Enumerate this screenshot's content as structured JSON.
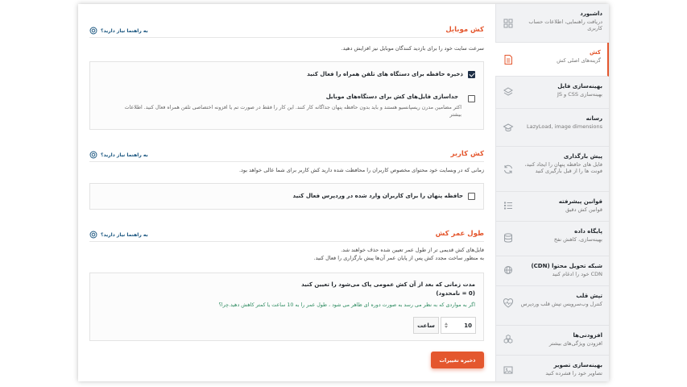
{
  "colors": {
    "accent": "#e4572e",
    "link": "#15527d",
    "nav_active_bg": "#ffffff"
  },
  "sidebar": {
    "items": [
      {
        "title": "داشبورد",
        "desc": "دریافت راهنمایی، اطلاعات حساب کاربری",
        "icon": "dashboard-icon"
      },
      {
        "title": "کش",
        "desc": "گزینه‌های اصلی کش",
        "icon": "file-cache-icon",
        "active": true
      },
      {
        "title": "بهینه‌سازی فایل",
        "desc": "بهینه‌سازی CSS و JS",
        "icon": "layers-icon"
      },
      {
        "title": "رسانه",
        "desc": "LazyLoad, image dimensions",
        "icon": "media-icon"
      },
      {
        "title": "پیش بارگذاری",
        "desc": "فایل های حافظه پنهان را ایجاد کنید، فونت ها را از قبل بارگیری کنید",
        "icon": "refresh-icon"
      },
      {
        "title": "قوانین پیشرفته",
        "desc": "قوانین کش دقیق",
        "icon": "rules-list-icon"
      },
      {
        "title": "پایگاه داده",
        "desc": "بهینه‌سازی، کاهش نفخ",
        "icon": "database-icon"
      },
      {
        "title": "شبکه تحویل محتوا (CDN)",
        "desc": "CDN خود را ادغام کنید",
        "icon": "cdn-icon"
      },
      {
        "title": "تپش قلب",
        "desc": "کنترل وب‌سرویس تپش قلب وردپرس",
        "icon": "heartbeat-icon"
      },
      {
        "title": "افزودنی‌ها",
        "desc": "افزودن ویژگی‌های بیشتر",
        "icon": "addons-icon"
      },
      {
        "title": "بهینه‌سازی تصویر",
        "desc": "تصاویر خود را فشرده کنید",
        "icon": "image-compress-icon"
      }
    ]
  },
  "help_label": "به راهنما نیاز دارید؟",
  "mobile_cache": {
    "title": "کش موبایل",
    "desc": "سرعت سایت خود را برای بازدید کنندگان موبایل نیز افزایش دهید.",
    "opt1_label": "ذخیره حافظه برای دستگاه های تلفن همراه را فعال کنید",
    "opt2_label": "جداسازی فایل‌های کش برای دستگاه‌های موبایل",
    "opt2_desc_line1": "اکثر مضامین مدرن ریسپانسیو هستند و باید بدون حافظه پنهان جداگانه کار کنند. این کار را فقط در صورت تم یا افزونه اختصاصی تلفن همراه فعال کنید. اطلاعات",
    "opt2_desc_line2": "بیشتر"
  },
  "user_cache": {
    "title": "کش کاربر",
    "desc": "زمانی که در وبسایت خود محتوای مخصوص کاربران را محافظت شده دارید کش کاربر برای شما عالی خواهد بود.",
    "opt_label": "حافظه پنهان را برای کاربران وارد شده در وردپرس فعال کنید"
  },
  "lifespan": {
    "title": "طول عمر کش",
    "desc_line1": "فایل‌های کش قدیمی تر از طول عمر تعیین شده حذف خواهند شد.",
    "desc_line2": "به منظور ساخت مجدد کش پس از پایان عمر آن‌ها پیش بارگزاری را فعال کنید.",
    "field_label": "مدت زمانی که بعد از آن کش عمومی پاک می‌شود را تعیین کنید",
    "field_hint": "(0 = نامحدود)",
    "warning": "اگر به مواردی که به نظر می رسد به صورت دوره ای ظاهر می شود ، طول عمر را به 10 ساعت یا کمتر کاهش دهید.چرا؟",
    "value": "10",
    "unit": "ساعت"
  },
  "save_label": "ذخیره تغییرات"
}
